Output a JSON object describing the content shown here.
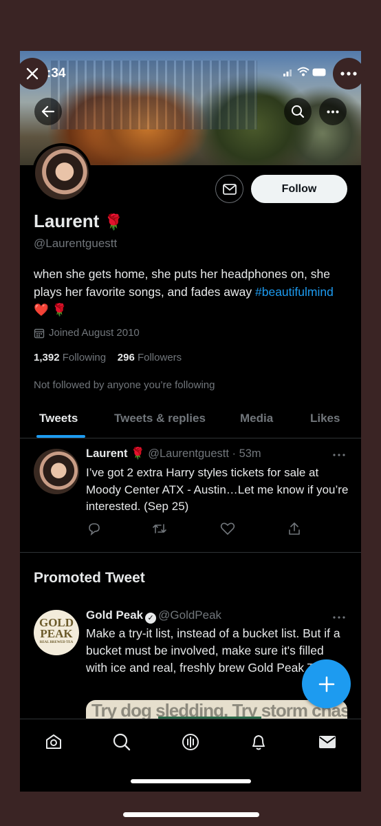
{
  "status_bar": {
    "time": ":34"
  },
  "profile": {
    "name": "Laurent",
    "name_emoji": "🌹",
    "handle": "@Laurentguestt",
    "bio_text": "when she gets home, she puts her headphones on, she plays her favorite songs, and fades away ",
    "bio_hashtag": "#beautifulmind",
    "bio_emojis": " ❤️ 🌹",
    "joined": "Joined August 2010",
    "following_count": "1,392",
    "following_label": "Following",
    "followers_count": "296",
    "followers_label": "Followers",
    "not_followed": "Not followed by anyone you’re following",
    "follow_label": "Follow"
  },
  "tabs": [
    {
      "label": "Tweets",
      "active": true
    },
    {
      "label": "Tweets & replies",
      "active": false
    },
    {
      "label": "Media",
      "active": false
    },
    {
      "label": "Likes",
      "active": false
    }
  ],
  "tweet": {
    "author": "Laurent",
    "author_emoji": "🌹",
    "handle_time": "@Laurentguestt · 53m",
    "text": "I’ve got 2 extra Harry styles tickets for sale at Moody Center ATX - Austin…Let me know if you’re interested. (Sep 25)"
  },
  "promoted": {
    "section_title": "Promoted Tweet",
    "logo_line1": "GOLD",
    "logo_line2": "PEAK",
    "logo_tag": "REAL BREWED TEA",
    "author": "Gold Peak",
    "handle": "@GoldPeak",
    "text": "Make a try-it list, instead of a bucket list. But if a bucket must be involved, make sure it's filled with ice and real, freshly brew Gold Peak Tea.",
    "image_text": "Try dog sledding. Try storm chasi"
  },
  "colors": {
    "accent": "#1d9bf0",
    "background": "#000000",
    "text_primary": "#e7e9ea",
    "text_secondary": "#71767b"
  },
  "icons": {
    "close": "close-icon",
    "more": "more-icon",
    "back": "back-arrow-icon",
    "search": "search-icon",
    "message": "envelope-icon",
    "calendar": "calendar-icon",
    "reply": "reply-icon",
    "retweet": "retweet-icon",
    "like": "heart-icon",
    "share": "share-icon",
    "compose": "plus-icon",
    "nav_home": "home-icon",
    "nav_search": "search-icon",
    "nav_spaces": "spaces-icon",
    "nav_notifications": "bell-icon",
    "nav_messages": "mail-icon"
  }
}
